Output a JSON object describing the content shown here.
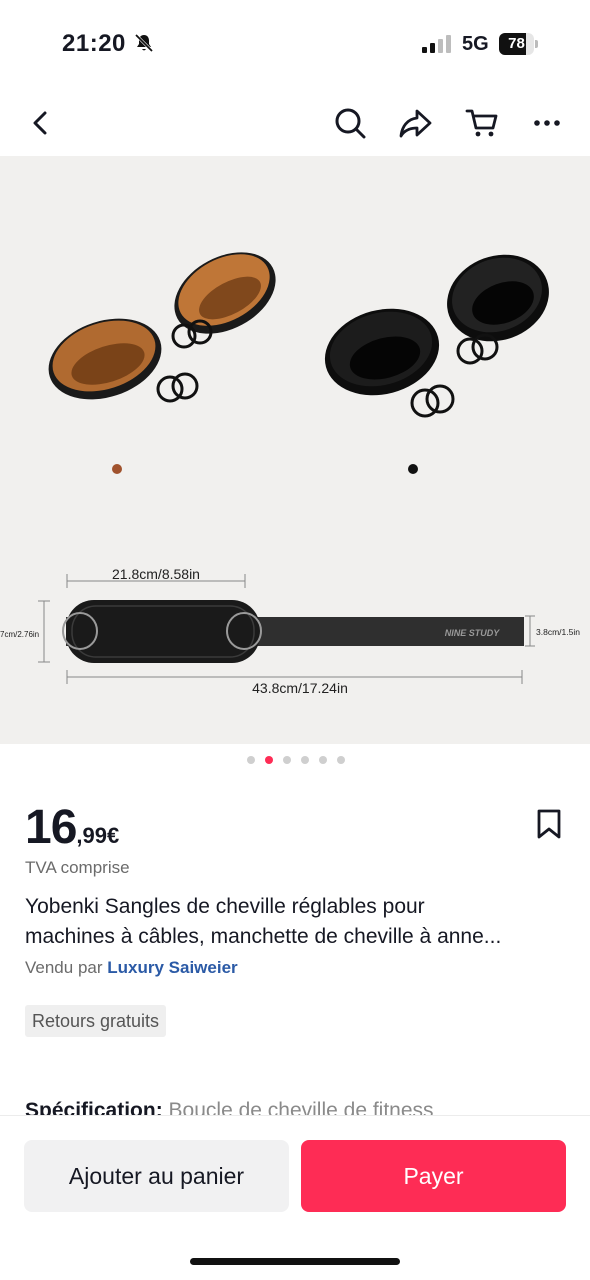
{
  "status_bar": {
    "time": "21:20",
    "network": "5G",
    "battery_level": "78",
    "battery_fraction": 0.78,
    "icons": [
      "bell-off-icon",
      "signal-icon"
    ]
  },
  "nav": {
    "icons": [
      "back-icon",
      "search-icon",
      "share-icon",
      "cart-icon",
      "more-icon"
    ]
  },
  "gallery": {
    "dimension_width_handle": "21.8cm/8.58in",
    "dimension_total_length": "43.8cm/17.24in",
    "dimension_height_left": "7cm/2.76in",
    "dimension_height_right": "3.8cm/1.5in",
    "strap_brand": "NINE STUDY",
    "current_index": 2,
    "total_images": 6,
    "swatch_colors": [
      "#a0522d",
      "#111111"
    ]
  },
  "price": {
    "integer": "16",
    "decimals": ",99€",
    "tax_note": "TVA comprise"
  },
  "product": {
    "title_line1": "Yobenki Sangles de cheville réglables pour",
    "title_line2": "machines à câbles, manchette de cheville à anne...",
    "seller_prefix": "Vendu par ",
    "seller_name": "Luxury Saiweier",
    "badge": "Retours gratuits",
    "spec_label": "Spécification:",
    "spec_value": " Boucle de cheville de fitness"
  },
  "actions": {
    "add_to_cart": "Ajouter au panier",
    "pay": "Payer"
  },
  "colors": {
    "accent": "#fe2c55",
    "seller_link": "#2b5aa6"
  }
}
